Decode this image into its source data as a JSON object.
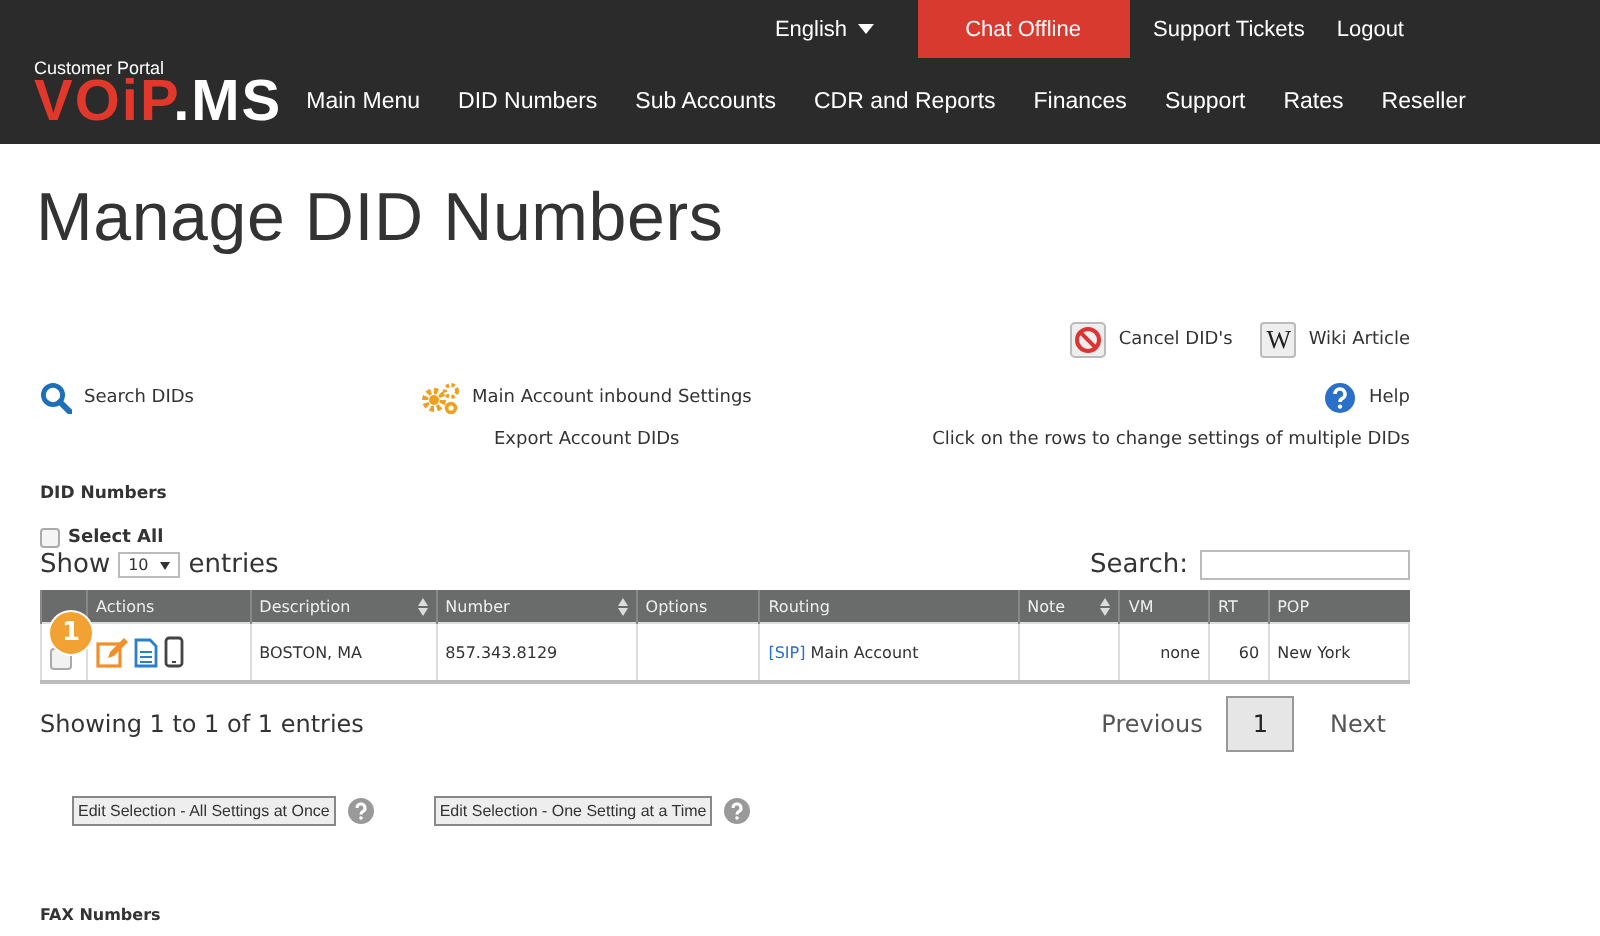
{
  "header": {
    "portal_label": "Customer Portal",
    "logo": [
      "VOiP",
      ".MS"
    ],
    "language": "English",
    "chat": "Chat Offline",
    "links": [
      "Support Tickets",
      "Logout"
    ],
    "nav": [
      "Main Menu",
      "DID Numbers",
      "Sub Accounts",
      "CDR and Reports",
      "Finances",
      "Support",
      "Rates",
      "Reseller"
    ]
  },
  "page_title": "Manage DID Numbers",
  "top_actions": [
    {
      "kind": "cancel",
      "label": "Cancel DID's"
    },
    {
      "kind": "wiki",
      "icon": "W",
      "label": "Wiki Article"
    }
  ],
  "tools": {
    "search": "Search DIDs",
    "settings": "Main Account inbound Settings",
    "export": "Export Account DIDs",
    "help": "Help",
    "hint": "Click on the rows to change settings of multiple DIDs"
  },
  "section": "DID Numbers",
  "select_all": {
    "label": "Select All",
    "checked": false
  },
  "length_menu": {
    "before": "Show",
    "value": "10",
    "after": "entries"
  },
  "search": {
    "label": "Search:"
  },
  "table": {
    "columns": [
      {
        "sortable": false
      },
      {
        "label": "Actions",
        "sortable": false
      },
      {
        "label": "Description",
        "sortable": true
      },
      {
        "label": "Number",
        "sortable": true
      },
      {
        "label": "Options",
        "sortable": false
      },
      {
        "label": "Routing",
        "sortable": false
      },
      {
        "label": "Note",
        "sortable": true
      },
      {
        "label": "VM",
        "sortable": false
      },
      {
        "label": "RT",
        "sortable": false
      },
      {
        "label": "POP",
        "sortable": false
      }
    ],
    "rows": [
      {
        "checked": false,
        "badge": "1",
        "description": "BOSTON, MA",
        "number": "857.343.8129",
        "options": "",
        "routing_tag": "[SIP]",
        "routing": "Main Account",
        "note": "",
        "vm": "none",
        "rt": "60",
        "pop": "New York"
      }
    ]
  },
  "info": "Showing 1 to 1 of 1 entries",
  "pagination": {
    "previous": "Previous",
    "pages": [
      {
        "label": "1",
        "selected": true
      }
    ],
    "next": "Next"
  },
  "edit_buttons": [
    "Edit Selection - All Settings at Once",
    "Edit Selection - One Setting at a Time"
  ],
  "fax_section": "FAX Numbers"
}
